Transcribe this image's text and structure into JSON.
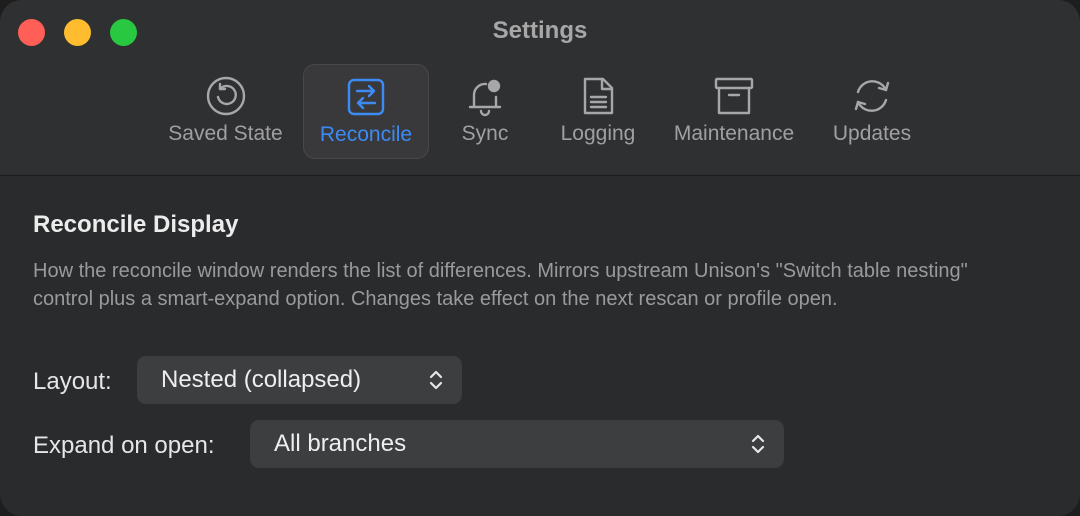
{
  "window": {
    "title": "Settings"
  },
  "toolbar": {
    "tabs": [
      {
        "label": "Saved State",
        "icon": "history-icon",
        "selected": false
      },
      {
        "label": "Reconcile",
        "icon": "reconcile-arrows-icon",
        "selected": true
      },
      {
        "label": "Sync",
        "icon": "bell-badge-icon",
        "selected": false
      },
      {
        "label": "Logging",
        "icon": "document-icon",
        "selected": false
      },
      {
        "label": "Maintenance",
        "icon": "archive-box-icon",
        "selected": false
      },
      {
        "label": "Updates",
        "icon": "refresh-icon",
        "selected": false
      }
    ]
  },
  "section": {
    "title": "Reconcile Display",
    "description": "How the reconcile window renders the list of differences. Mirrors upstream Unison's \"Switch table nesting\" control plus a smart-expand option. Changes take effect on the next rescan or profile open."
  },
  "form": {
    "layout": {
      "label": "Layout:",
      "value": "Nested (collapsed)"
    },
    "expand_on_open": {
      "label": "Expand on open:",
      "value": "All branches"
    }
  },
  "colors": {
    "accent": "#3c8bf5",
    "close": "#ff5f57",
    "minimize": "#febc2e",
    "maximize": "#28c840"
  }
}
